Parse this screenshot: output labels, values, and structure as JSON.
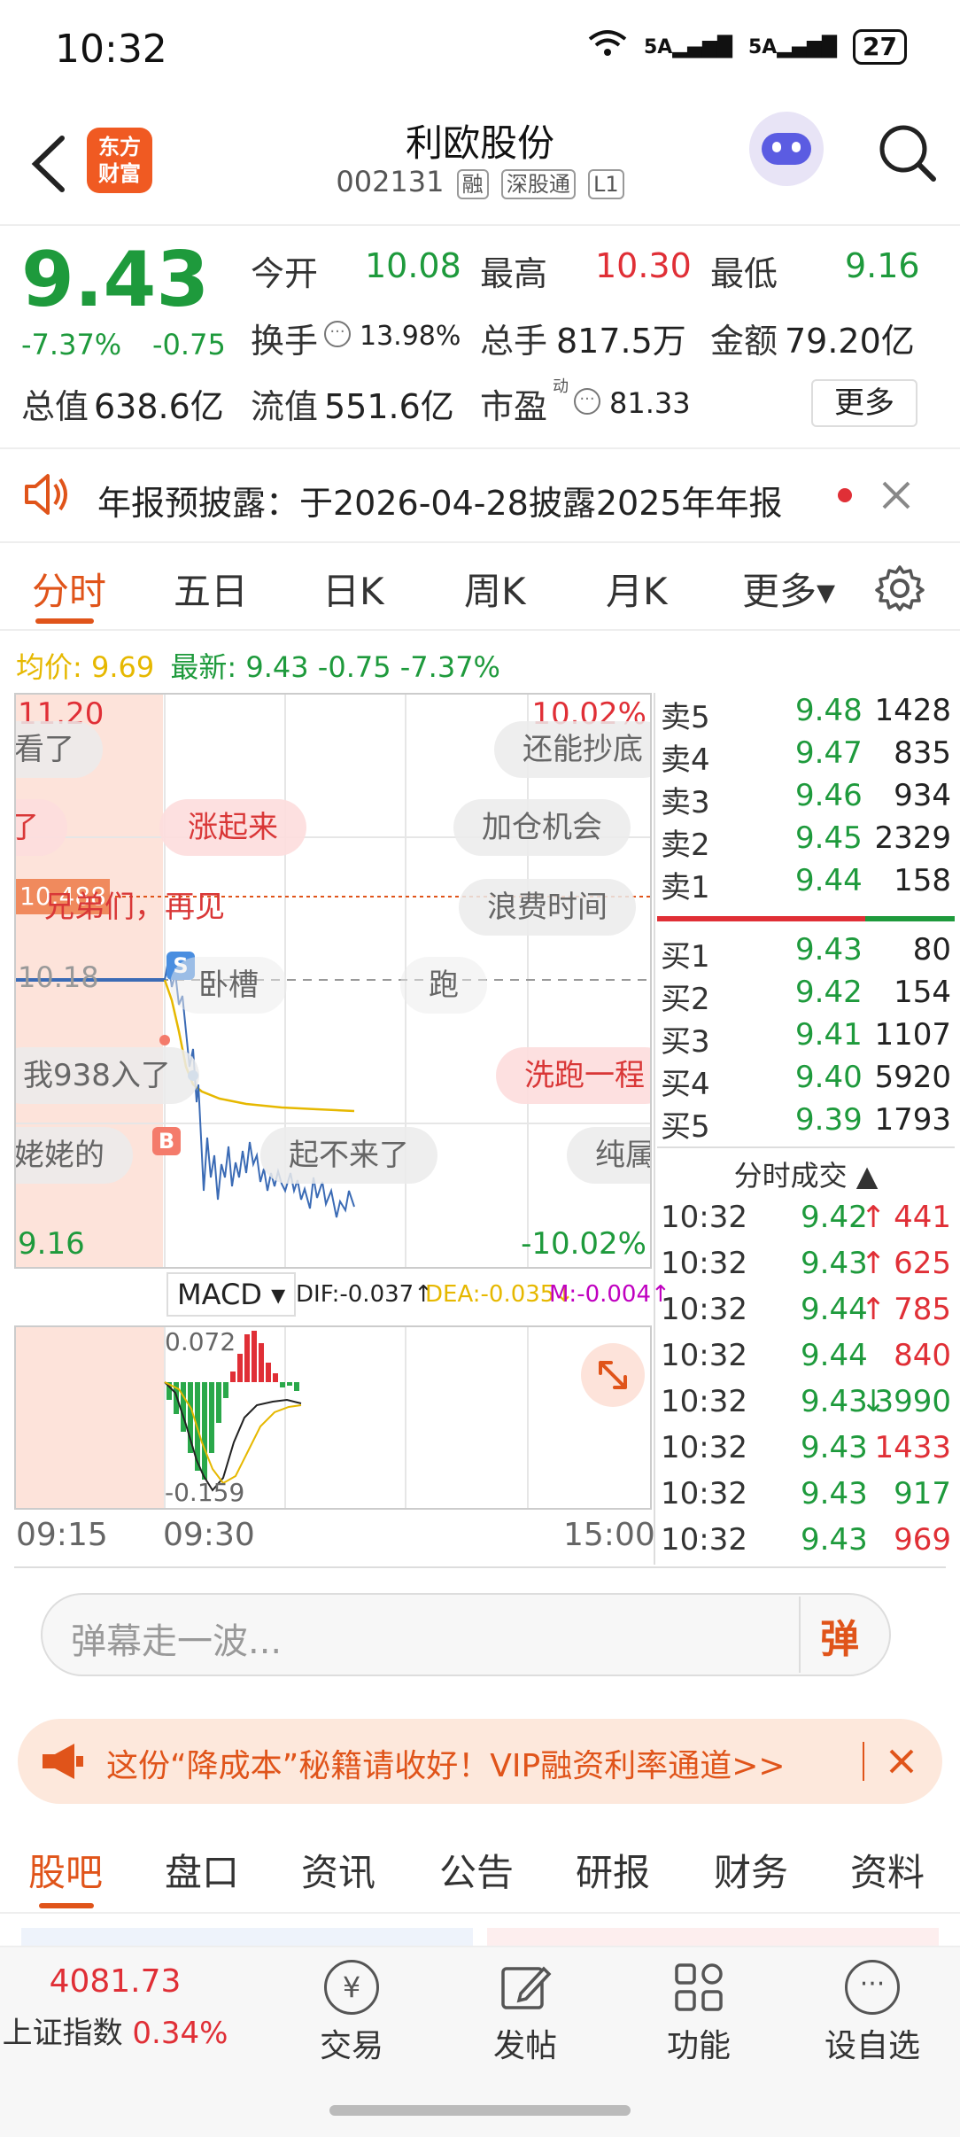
{
  "status": {
    "time": "10:32",
    "net1": "5A",
    "net2": "5A",
    "battery": "27"
  },
  "header": {
    "logo_text": "东方\n财富",
    "title": "利欧股份",
    "code": "002131",
    "tags": [
      "融",
      "深股通",
      "L1"
    ]
  },
  "quote": {
    "price": "9.43",
    "change_pct": "-7.37%",
    "change": "-0.75",
    "fields": [
      {
        "label": "今开",
        "value": "10.08",
        "color": "green"
      },
      {
        "label": "最高",
        "value": "10.30",
        "color": "red"
      },
      {
        "label": "最低",
        "value": "9.16",
        "color": "green"
      },
      {
        "label": "换手",
        "value": "13.98%"
      },
      {
        "label": "总手",
        "value": "817.5万"
      },
      {
        "label": "金额",
        "value": "79.20亿"
      },
      {
        "label": "总值",
        "value": "638.6亿"
      },
      {
        "label": "流值",
        "value": "551.6亿"
      },
      {
        "label": "市盈",
        "value": "81.33",
        "sup": "动"
      }
    ],
    "more": "更多"
  },
  "notice": {
    "text": "年报预披露：于2026-04-28披露2025年年报"
  },
  "tabs": [
    "分时",
    "五日",
    "日K",
    "周K",
    "月K",
    "更多",
    ""
  ],
  "tabs_more": "更多▾",
  "intraday": {
    "avg_label": "均价: ",
    "avg_value": "9.69",
    "latest_label": "最新: ",
    "latest_value": "9.43 -0.75 -7.37%",
    "top_price": "11.20",
    "top_pct": "10.02%",
    "bottom_price": "9.16",
    "bottom_pct": "-10.02%",
    "ref_price": "10.18",
    "high_line": "10.488",
    "time_start": "09:15",
    "time_open": "09:30",
    "time_end": "15:00",
    "marker_s": "S",
    "marker_b": "B"
  },
  "danmaku": [
    {
      "text": "看了",
      "style": "grey"
    },
    {
      "text": "还能抄底",
      "style": "grey"
    },
    {
      "text": "了",
      "style": "pink"
    },
    {
      "text": "涨起来",
      "style": "pink"
    },
    {
      "text": "加仓机会",
      "style": "grey"
    },
    {
      "text": "兄弟们，再见",
      "style": "pink"
    },
    {
      "text": "浪费时间",
      "style": "grey"
    },
    {
      "text": "卧槽",
      "style": "grey"
    },
    {
      "text": "跑",
      "style": "grey"
    },
    {
      "text": "我938入了",
      "style": "grey"
    },
    {
      "text": "洗跑一程",
      "style": "pink"
    },
    {
      "text": "姥姥的",
      "style": "grey"
    },
    {
      "text": "起不来了",
      "style": "grey"
    },
    {
      "text": "纯属",
      "style": "grey"
    }
  ],
  "orderbook": {
    "asks": [
      {
        "label": "卖5",
        "price": "9.48",
        "vol": "1428"
      },
      {
        "label": "卖4",
        "price": "9.47",
        "vol": "835"
      },
      {
        "label": "卖3",
        "price": "9.46",
        "vol": "934"
      },
      {
        "label": "卖2",
        "price": "9.45",
        "vol": "2329"
      },
      {
        "label": "卖1",
        "price": "9.44",
        "vol": "158"
      }
    ],
    "bids": [
      {
        "label": "买1",
        "price": "9.43",
        "vol": "80"
      },
      {
        "label": "买2",
        "price": "9.42",
        "vol": "154"
      },
      {
        "label": "买3",
        "price": "9.41",
        "vol": "1107"
      },
      {
        "label": "买4",
        "price": "9.40",
        "vol": "5920"
      },
      {
        "label": "买5",
        "price": "9.39",
        "vol": "1793"
      }
    ],
    "ticks_title": "分时成交 ▲",
    "ticks": [
      {
        "time": "10:32",
        "price": "9.42",
        "arrow": "↑",
        "vol": "441"
      },
      {
        "time": "10:32",
        "price": "9.43",
        "arrow": "↑",
        "vol": "625"
      },
      {
        "time": "10:32",
        "price": "9.44",
        "arrow": "↑",
        "vol": "785"
      },
      {
        "time": "10:32",
        "price": "9.44",
        "arrow": "",
        "vol": "840"
      },
      {
        "time": "10:32",
        "price": "9.43",
        "arrow": "↓",
        "vol": "3990"
      },
      {
        "time": "10:32",
        "price": "9.43",
        "arrow": "",
        "vol": "1433"
      },
      {
        "time": "10:32",
        "price": "9.43",
        "arrow": "",
        "vol": "917"
      },
      {
        "time": "10:32",
        "price": "9.43",
        "arrow": "",
        "vol": "969"
      }
    ]
  },
  "macd": {
    "label": "MACD ▾",
    "dif": "DIF:-0.037↑",
    "dea": "DEA:-0.035↓",
    "m": "M:-0.004↑",
    "top": "0.072",
    "bottom": "-0.159"
  },
  "danmu_input": {
    "placeholder": "弹幕走一波...",
    "button": "弹"
  },
  "promo": {
    "text": "这份“降成本”秘籍请收好！VIP融资利率通道>>"
  },
  "bottom_tabs": [
    "股吧",
    "盘口",
    "资讯",
    "公告",
    "研报",
    "财务",
    "资料"
  ],
  "footer": {
    "index_value": "4081.73",
    "index_name": "上证指数",
    "index_change": "0.34%",
    "items": [
      "交易",
      "发帖",
      "功能",
      "设自选"
    ]
  },
  "colors": {
    "up": "#e02f36",
    "down": "#1e9a3c",
    "accent": "#e0541a",
    "price_line": "#3b6bb5",
    "avg_line": "#e6b800"
  }
}
